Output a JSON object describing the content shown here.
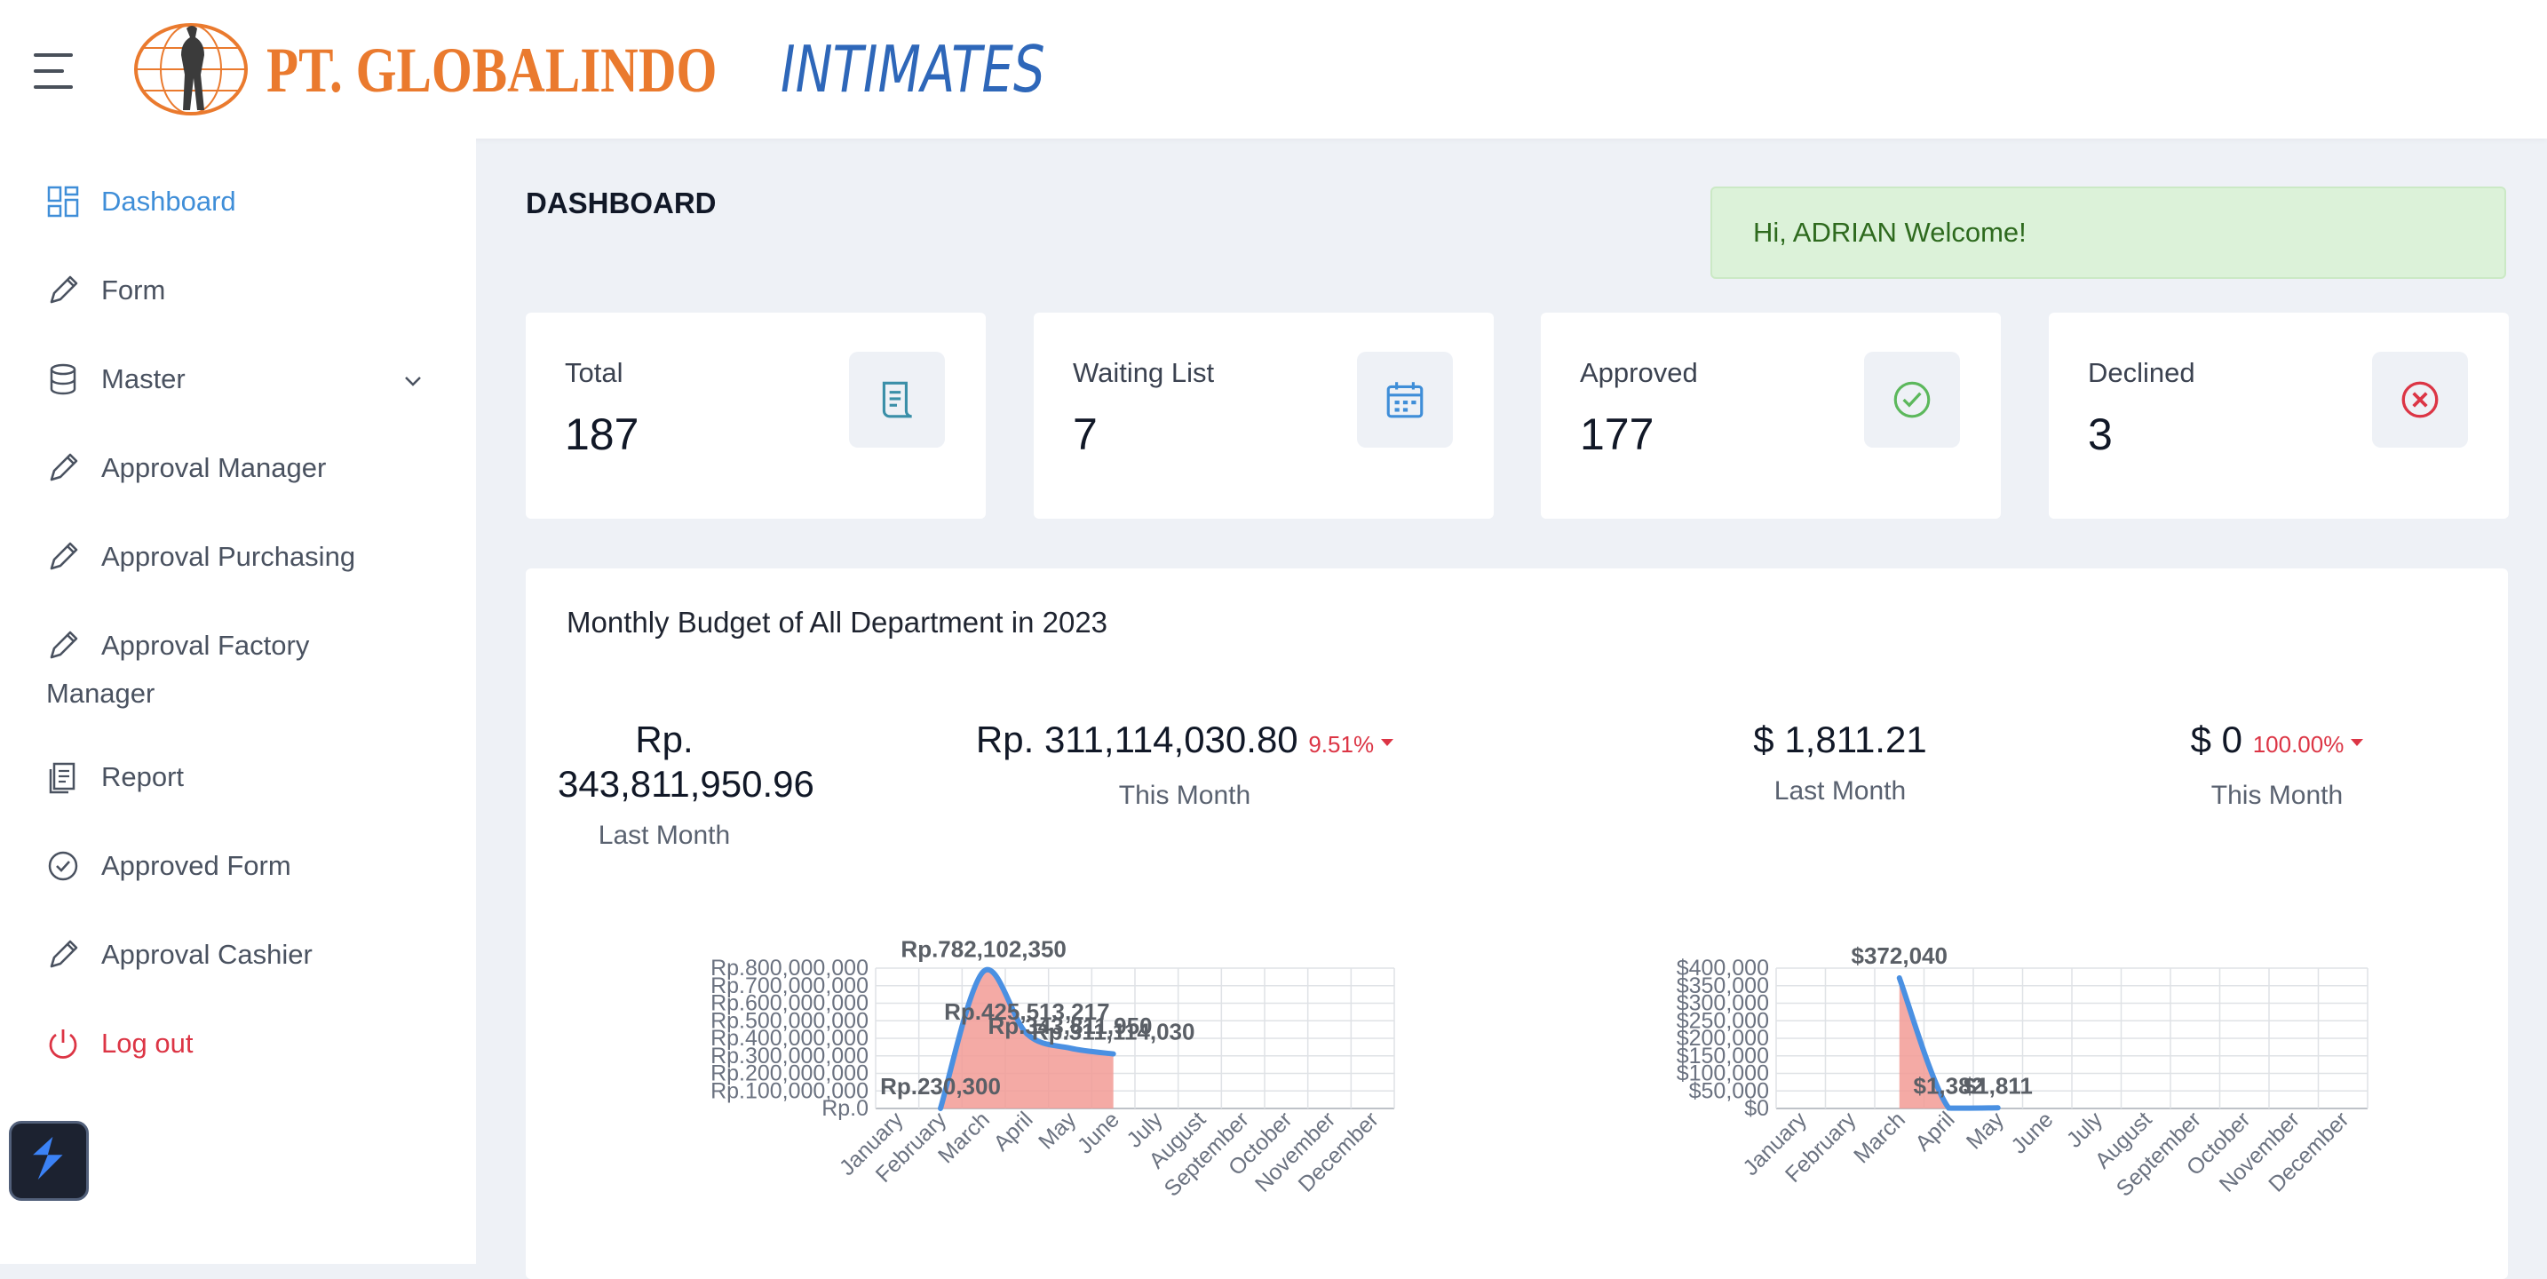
{
  "brand": {
    "name_part1": "PT. GLOBALINDO",
    "name_part2": "INTIMATES",
    "color_orange": "#ea7a2e",
    "color_blue": "#2e67b9"
  },
  "sidebar": {
    "items": [
      {
        "label": "Dashboard",
        "icon": "dashboard-grid-icon",
        "active": true
      },
      {
        "label": "Form",
        "icon": "pencil-icon"
      },
      {
        "label": "Master",
        "icon": "database-icon",
        "has_submenu": true
      },
      {
        "label": "Approval Manager",
        "icon": "pencil-icon"
      },
      {
        "label": "Approval Purchasing",
        "icon": "pencil-icon"
      },
      {
        "label": "Approval Factory",
        "label_line2": "Manager",
        "icon": "pencil-icon"
      },
      {
        "label": "Report",
        "icon": "documents-icon"
      },
      {
        "label": "Approved Form",
        "icon": "check-circle-icon"
      },
      {
        "label": "Approval Cashier",
        "icon": "pencil-icon"
      },
      {
        "label": "Log out",
        "icon": "power-icon"
      }
    ]
  },
  "header": {
    "title": "DASHBOARD",
    "welcome": "Hi, ADRIAN Welcome!"
  },
  "cards": [
    {
      "label": "Total",
      "value": "187",
      "icon": "document-icon",
      "icon_color": "#3a8fa8"
    },
    {
      "label": "Waiting List",
      "value": "7",
      "icon": "calendar-icon",
      "icon_color": "#3f8ed8"
    },
    {
      "label": "Approved",
      "value": "177",
      "icon": "check-circle-icon",
      "icon_color": "#5cb85c"
    },
    {
      "label": "Declined",
      "value": "3",
      "icon": "x-circle-icon",
      "icon_color": "#dc3545"
    }
  ],
  "panel": {
    "title": "Monthly Budget of All Department in 2023",
    "stats": [
      {
        "value_line1": "Rp.",
        "value_line2": "343,811,950.96",
        "label": "Last Month"
      },
      {
        "value": "Rp. 311,114,030.80",
        "pct": "9.51%",
        "label": "This Month"
      },
      {
        "value": "$ 1,811.21",
        "label": "Last Month"
      },
      {
        "value": "$ 0",
        "pct": "100.00%",
        "label": "This Month"
      }
    ]
  },
  "chart_data": [
    {
      "type": "area",
      "x": [
        "January",
        "February",
        "March",
        "April",
        "May",
        "June",
        "July",
        "August",
        "September",
        "October",
        "November",
        "December"
      ],
      "values": [
        null,
        230300,
        782102350,
        425513217,
        343811950,
        311114030,
        null,
        null,
        null,
        null,
        null,
        null
      ],
      "data_labels": [
        "Rp.230,300",
        "Rp.782,102,350",
        "Rp.425,513,217",
        "Rp.343,811,950",
        "Rp.311,114,030"
      ],
      "y_ticks": [
        "Rp.0",
        "Rp.100,000,000",
        "Rp.200,000,000",
        "Rp.300,000,000",
        "Rp.400,000,000",
        "Rp.500,000,000",
        "Rp.600,000,000",
        "Rp.700,000,000",
        "Rp.800,000,000"
      ],
      "ylim": [
        0,
        800000000
      ],
      "line_color": "#4a90e2",
      "fill_color": "#f29b95",
      "grid": true
    },
    {
      "type": "area",
      "x": [
        "January",
        "February",
        "March",
        "April",
        "May",
        "June",
        "July",
        "August",
        "September",
        "October",
        "November",
        "December"
      ],
      "values": [
        null,
        null,
        372040,
        1382,
        1811,
        null,
        null,
        null,
        null,
        null,
        null,
        null
      ],
      "data_labels": [
        "$372,040",
        "$1,382",
        "$1,811"
      ],
      "y_ticks": [
        "$0",
        "$50,000",
        "$100,000",
        "$150,000",
        "$200,000",
        "$250,000",
        "$300,000",
        "$350,000",
        "$400,000"
      ],
      "ylim": [
        0,
        400000
      ],
      "line_color": "#4a90e2",
      "fill_color": "#f29b95",
      "grid": true
    }
  ]
}
